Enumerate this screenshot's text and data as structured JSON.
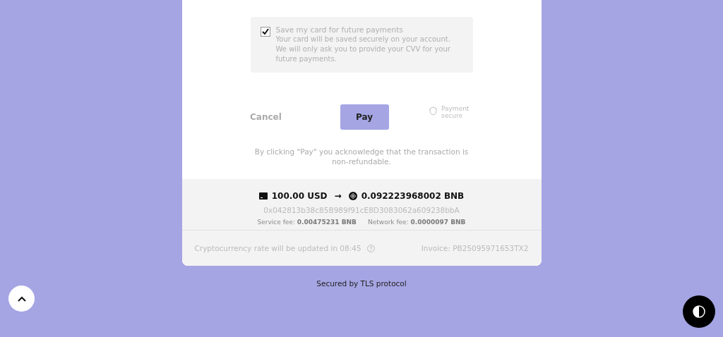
{
  "save_card": {
    "checked": true,
    "title": "Save my card for future payments",
    "description": "Your card will be saved securely on your account. We will only ask you to provide your CVV for your future payments."
  },
  "actions": {
    "cancel": "Cancel",
    "pay": "Pay",
    "secure_note": "Payment secure"
  },
  "disclaimer": "By clicking \"Pay\" you acknowledge that the transaction is non-refundable.",
  "conversion": {
    "from": "100.00 USD",
    "arrow": "→",
    "to": "0.092223968002 BNB"
  },
  "address": "0x042813b38c85B989f91cE8D3083062a609238bbA",
  "fees": [
    "Service fee: **0.00475231 BNB**",
    "Network fee: **0.0000097 BNB**"
  ],
  "rate_note": "Cryptocurrency rate will be updated in 08:45",
  "invoice": "Invoice: PB25095971653TX2",
  "secured_by": "Secured by TLS protocol"
}
